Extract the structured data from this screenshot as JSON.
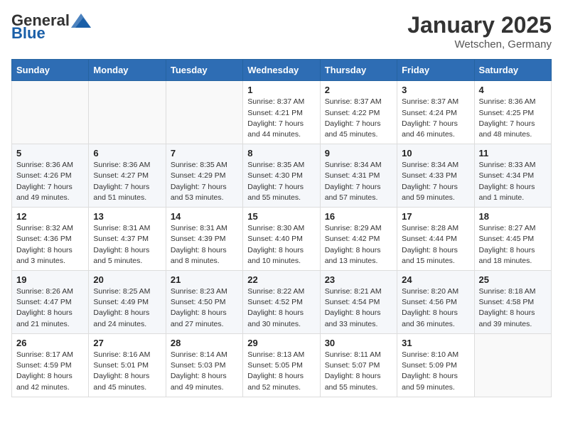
{
  "logo": {
    "general": "General",
    "blue": "Blue"
  },
  "title": "January 2025",
  "location": "Wetschen, Germany",
  "weekdays": [
    "Sunday",
    "Monday",
    "Tuesday",
    "Wednesday",
    "Thursday",
    "Friday",
    "Saturday"
  ],
  "weeks": [
    [
      {
        "day": "",
        "info": ""
      },
      {
        "day": "",
        "info": ""
      },
      {
        "day": "",
        "info": ""
      },
      {
        "day": "1",
        "info": "Sunrise: 8:37 AM\nSunset: 4:21 PM\nDaylight: 7 hours\nand 44 minutes."
      },
      {
        "day": "2",
        "info": "Sunrise: 8:37 AM\nSunset: 4:22 PM\nDaylight: 7 hours\nand 45 minutes."
      },
      {
        "day": "3",
        "info": "Sunrise: 8:37 AM\nSunset: 4:24 PM\nDaylight: 7 hours\nand 46 minutes."
      },
      {
        "day": "4",
        "info": "Sunrise: 8:36 AM\nSunset: 4:25 PM\nDaylight: 7 hours\nand 48 minutes."
      }
    ],
    [
      {
        "day": "5",
        "info": "Sunrise: 8:36 AM\nSunset: 4:26 PM\nDaylight: 7 hours\nand 49 minutes."
      },
      {
        "day": "6",
        "info": "Sunrise: 8:36 AM\nSunset: 4:27 PM\nDaylight: 7 hours\nand 51 minutes."
      },
      {
        "day": "7",
        "info": "Sunrise: 8:35 AM\nSunset: 4:29 PM\nDaylight: 7 hours\nand 53 minutes."
      },
      {
        "day": "8",
        "info": "Sunrise: 8:35 AM\nSunset: 4:30 PM\nDaylight: 7 hours\nand 55 minutes."
      },
      {
        "day": "9",
        "info": "Sunrise: 8:34 AM\nSunset: 4:31 PM\nDaylight: 7 hours\nand 57 minutes."
      },
      {
        "day": "10",
        "info": "Sunrise: 8:34 AM\nSunset: 4:33 PM\nDaylight: 7 hours\nand 59 minutes."
      },
      {
        "day": "11",
        "info": "Sunrise: 8:33 AM\nSunset: 4:34 PM\nDaylight: 8 hours\nand 1 minute."
      }
    ],
    [
      {
        "day": "12",
        "info": "Sunrise: 8:32 AM\nSunset: 4:36 PM\nDaylight: 8 hours\nand 3 minutes."
      },
      {
        "day": "13",
        "info": "Sunrise: 8:31 AM\nSunset: 4:37 PM\nDaylight: 8 hours\nand 5 minutes."
      },
      {
        "day": "14",
        "info": "Sunrise: 8:31 AM\nSunset: 4:39 PM\nDaylight: 8 hours\nand 8 minutes."
      },
      {
        "day": "15",
        "info": "Sunrise: 8:30 AM\nSunset: 4:40 PM\nDaylight: 8 hours\nand 10 minutes."
      },
      {
        "day": "16",
        "info": "Sunrise: 8:29 AM\nSunset: 4:42 PM\nDaylight: 8 hours\nand 13 minutes."
      },
      {
        "day": "17",
        "info": "Sunrise: 8:28 AM\nSunset: 4:44 PM\nDaylight: 8 hours\nand 15 minutes."
      },
      {
        "day": "18",
        "info": "Sunrise: 8:27 AM\nSunset: 4:45 PM\nDaylight: 8 hours\nand 18 minutes."
      }
    ],
    [
      {
        "day": "19",
        "info": "Sunrise: 8:26 AM\nSunset: 4:47 PM\nDaylight: 8 hours\nand 21 minutes."
      },
      {
        "day": "20",
        "info": "Sunrise: 8:25 AM\nSunset: 4:49 PM\nDaylight: 8 hours\nand 24 minutes."
      },
      {
        "day": "21",
        "info": "Sunrise: 8:23 AM\nSunset: 4:50 PM\nDaylight: 8 hours\nand 27 minutes."
      },
      {
        "day": "22",
        "info": "Sunrise: 8:22 AM\nSunset: 4:52 PM\nDaylight: 8 hours\nand 30 minutes."
      },
      {
        "day": "23",
        "info": "Sunrise: 8:21 AM\nSunset: 4:54 PM\nDaylight: 8 hours\nand 33 minutes."
      },
      {
        "day": "24",
        "info": "Sunrise: 8:20 AM\nSunset: 4:56 PM\nDaylight: 8 hours\nand 36 minutes."
      },
      {
        "day": "25",
        "info": "Sunrise: 8:18 AM\nSunset: 4:58 PM\nDaylight: 8 hours\nand 39 minutes."
      }
    ],
    [
      {
        "day": "26",
        "info": "Sunrise: 8:17 AM\nSunset: 4:59 PM\nDaylight: 8 hours\nand 42 minutes."
      },
      {
        "day": "27",
        "info": "Sunrise: 8:16 AM\nSunset: 5:01 PM\nDaylight: 8 hours\nand 45 minutes."
      },
      {
        "day": "28",
        "info": "Sunrise: 8:14 AM\nSunset: 5:03 PM\nDaylight: 8 hours\nand 49 minutes."
      },
      {
        "day": "29",
        "info": "Sunrise: 8:13 AM\nSunset: 5:05 PM\nDaylight: 8 hours\nand 52 minutes."
      },
      {
        "day": "30",
        "info": "Sunrise: 8:11 AM\nSunset: 5:07 PM\nDaylight: 8 hours\nand 55 minutes."
      },
      {
        "day": "31",
        "info": "Sunrise: 8:10 AM\nSunset: 5:09 PM\nDaylight: 8 hours\nand 59 minutes."
      },
      {
        "day": "",
        "info": ""
      }
    ]
  ]
}
